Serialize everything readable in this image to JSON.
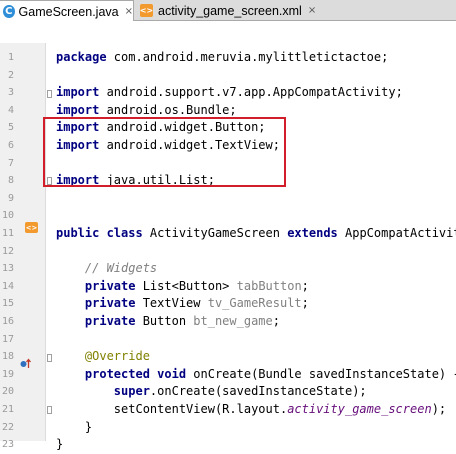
{
  "tabs": [
    {
      "label": "GameScreen.java",
      "close": "×",
      "icon": "java-class-icon",
      "active": true
    },
    {
      "label": "activity_game_screen.xml",
      "close": "×",
      "icon": "xml-layout-icon",
      "active": false
    }
  ],
  "gutter_icons": {
    "class_marker": "<>",
    "override_marker": "override-up-arrow-icon"
  },
  "editor": {
    "lines": [
      {
        "n": "1",
        "tokens": [
          {
            "t": "package",
            "c": "kw"
          },
          {
            "t": " com.android.meruvia.mylittletictactoe;",
            "c": ""
          }
        ]
      },
      {
        "n": "2",
        "tokens": []
      },
      {
        "n": "3",
        "tokens": [
          {
            "t": "import",
            "c": "kw"
          },
          {
            "t": " android.support.v7.app.AppCompatActivity;",
            "c": ""
          }
        ]
      },
      {
        "n": "4",
        "tokens": [
          {
            "t": "import",
            "c": "kw"
          },
          {
            "t": " android.os.Bundle;",
            "c": ""
          }
        ]
      },
      {
        "n": "5",
        "tokens": [
          {
            "t": "import",
            "c": "kw"
          },
          {
            "t": " android.widget.Button;",
            "c": ""
          }
        ]
      },
      {
        "n": "6",
        "tokens": [
          {
            "t": "import",
            "c": "kw"
          },
          {
            "t": " android.widget.TextView;",
            "c": ""
          }
        ]
      },
      {
        "n": "7",
        "tokens": []
      },
      {
        "n": "8",
        "tokens": [
          {
            "t": "import",
            "c": "kw"
          },
          {
            "t": " java.util.List;",
            "c": ""
          }
        ]
      },
      {
        "n": "9",
        "tokens": []
      },
      {
        "n": "10",
        "tokens": []
      },
      {
        "n": "11",
        "tokens": [
          {
            "t": "public class",
            "c": "kw"
          },
          {
            "t": " ActivityGameScreen ",
            "c": ""
          },
          {
            "t": "extends",
            "c": "kw"
          },
          {
            "t": " AppCompatActivity",
            "c": ""
          }
        ]
      },
      {
        "n": "12",
        "tokens": []
      },
      {
        "n": "13",
        "tokens": [
          {
            "t": "    // Widgets",
            "c": "cm"
          }
        ]
      },
      {
        "n": "14",
        "tokens": [
          {
            "t": "    ",
            "c": ""
          },
          {
            "t": "private",
            "c": "kw"
          },
          {
            "t": " List<Button> ",
            "c": ""
          },
          {
            "t": "tabButton",
            "c": "un"
          },
          {
            "t": ";",
            "c": ""
          }
        ]
      },
      {
        "n": "15",
        "tokens": [
          {
            "t": "    ",
            "c": ""
          },
          {
            "t": "private",
            "c": "kw"
          },
          {
            "t": " TextView ",
            "c": ""
          },
          {
            "t": "tv_GameResult",
            "c": "un"
          },
          {
            "t": ";",
            "c": ""
          }
        ]
      },
      {
        "n": "16",
        "tokens": [
          {
            "t": "    ",
            "c": ""
          },
          {
            "t": "private",
            "c": "kw"
          },
          {
            "t": " Button ",
            "c": ""
          },
          {
            "t": "bt_new_game",
            "c": "un"
          },
          {
            "t": ";",
            "c": ""
          }
        ]
      },
      {
        "n": "17",
        "tokens": []
      },
      {
        "n": "18",
        "tokens": [
          {
            "t": "    @Override",
            "c": "an"
          }
        ]
      },
      {
        "n": "19",
        "tokens": [
          {
            "t": "    ",
            "c": ""
          },
          {
            "t": "protected void",
            "c": "kw"
          },
          {
            "t": " onCreate(Bundle savedInstanceState) {",
            "c": ""
          }
        ]
      },
      {
        "n": "20",
        "tokens": [
          {
            "t": "        ",
            "c": ""
          },
          {
            "t": "super",
            "c": "kw"
          },
          {
            "t": ".onCreate(savedInstanceState);",
            "c": ""
          }
        ]
      },
      {
        "n": "21",
        "tokens": [
          {
            "t": "        setContentView(R.layout.",
            "c": ""
          },
          {
            "t": "activity_game_screen",
            "c": "res"
          },
          {
            "t": ");",
            "c": ""
          }
        ]
      },
      {
        "n": "22",
        "tokens": [
          {
            "t": "    }",
            "c": ""
          }
        ]
      },
      {
        "n": "23",
        "tokens": [
          {
            "t": "}",
            "c": ""
          }
        ]
      }
    ]
  },
  "colors": {
    "keyword": "#000080",
    "comment": "#808080",
    "annotation": "#808000",
    "resource": "#660e7a",
    "highlight_box": "#d21d2a"
  }
}
